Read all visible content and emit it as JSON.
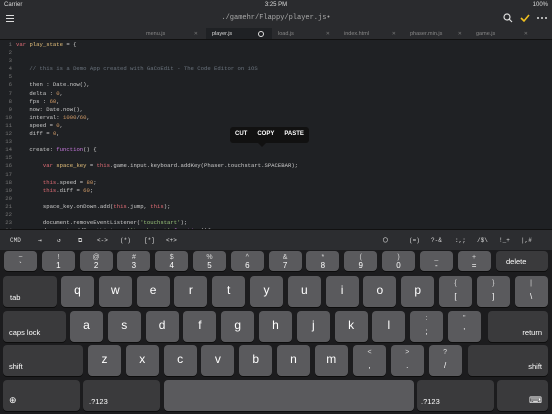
{
  "status": {
    "carrier": "Carrier",
    "time": "3:25 PM",
    "battery": "100%"
  },
  "title": {
    "path": "./gamehr/Flappy/player.js•"
  },
  "tabs": [
    {
      "label": "menu.js",
      "active": false
    },
    {
      "label": "player.js",
      "active": true
    },
    {
      "label": "load.js",
      "active": false
    },
    {
      "label": "index.html",
      "active": false
    },
    {
      "label": "phaser.min.js",
      "active": false
    },
    {
      "label": "game.js",
      "active": false
    }
  ],
  "code": {
    "lines": [
      {
        "n": "1",
        "segs": [
          [
            "kw",
            "var "
          ],
          [
            "var",
            "play_state"
          ],
          [
            "plain",
            " = {"
          ]
        ]
      },
      {
        "n": "2",
        "segs": []
      },
      {
        "n": "3",
        "segs": []
      },
      {
        "n": "4",
        "segs": [
          [
            "comment",
            "    // this is a Demo App created with GaCoEdit - The Code Editor on iOS"
          ]
        ]
      },
      {
        "n": "5",
        "segs": []
      },
      {
        "n": "6",
        "segs": [
          [
            "plain",
            "    then : Date.now(),"
          ]
        ]
      },
      {
        "n": "7",
        "segs": [
          [
            "plain",
            "    delta : "
          ],
          [
            "num",
            "0"
          ],
          [
            "plain",
            ","
          ]
        ]
      },
      {
        "n": "8",
        "segs": [
          [
            "plain",
            "    fps : "
          ],
          [
            "num",
            "60"
          ],
          [
            "plain",
            ","
          ]
        ]
      },
      {
        "n": "9",
        "segs": [
          [
            "plain",
            "    now: Date.now(),"
          ]
        ]
      },
      {
        "n": "10",
        "segs": [
          [
            "plain",
            "    interval: "
          ],
          [
            "num",
            "1000"
          ],
          [
            "plain",
            "/"
          ],
          [
            "num",
            "60"
          ],
          [
            "plain",
            ","
          ]
        ]
      },
      {
        "n": "11",
        "segs": [
          [
            "plain",
            "    speed = "
          ],
          [
            "num",
            "0"
          ],
          [
            "plain",
            ","
          ]
        ]
      },
      {
        "n": "12",
        "segs": [
          [
            "plain",
            "    diff = "
          ],
          [
            "num",
            "0"
          ],
          [
            "plain",
            ","
          ]
        ]
      },
      {
        "n": "13",
        "segs": []
      },
      {
        "n": "14",
        "segs": [
          [
            "plain",
            "    create: "
          ],
          [
            "fn",
            "function"
          ],
          [
            "plain",
            "() {"
          ]
        ]
      },
      {
        "n": "15",
        "segs": []
      },
      {
        "n": "16",
        "segs": [
          [
            "plain",
            "        "
          ],
          [
            "kw",
            "var "
          ],
          [
            "var",
            "space_key"
          ],
          [
            "plain",
            " = "
          ],
          [
            "kw",
            "this"
          ],
          [
            "plain",
            ".game.input.keyboard.addKey(Phaser."
          ],
          [
            "sel",
            "touchstart"
          ],
          [
            "plain",
            ".SPACEBAR);"
          ]
        ]
      },
      {
        "n": "17",
        "segs": []
      },
      {
        "n": "18",
        "segs": [
          [
            "plain",
            "        "
          ],
          [
            "kw",
            "this"
          ],
          [
            "plain",
            ".speed = "
          ],
          [
            "num",
            "80"
          ],
          [
            "plain",
            ";"
          ]
        ]
      },
      {
        "n": "19",
        "segs": [
          [
            "plain",
            "        "
          ],
          [
            "kw",
            "this"
          ],
          [
            "plain",
            ".diff = "
          ],
          [
            "num",
            "60"
          ],
          [
            "plain",
            ";"
          ]
        ]
      },
      {
        "n": "20",
        "segs": []
      },
      {
        "n": "21",
        "segs": [
          [
            "plain",
            "        space_key.onDown.add("
          ],
          [
            "kw",
            "this"
          ],
          [
            "plain",
            ".jump, "
          ],
          [
            "kw",
            "this"
          ],
          [
            "plain",
            ");"
          ]
        ]
      },
      {
        "n": "22",
        "segs": []
      },
      {
        "n": "23",
        "segs": [
          [
            "plain",
            "        document.removeEventListener("
          ],
          [
            "str",
            "'touchstart'"
          ],
          [
            "plain",
            ");"
          ]
        ]
      },
      {
        "n": "24",
        "segs": [
          [
            "plain",
            "        document.addEventListener("
          ],
          [
            "str",
            "'touchstart'"
          ],
          [
            "plain",
            ","
          ],
          [
            "fn",
            "function"
          ],
          [
            "plain",
            "(){"
          ]
        ]
      }
    ]
  },
  "context_menu": [
    "CUT",
    "COPY",
    "PASTE"
  ],
  "accessory": {
    "left": [
      "CMD",
      "⇥",
      "↺",
      "⧉",
      "<->",
      "(*)",
      "[*]",
      "<+>"
    ],
    "right": [
      "◯",
      "(=)",
      "?-&",
      ":,;",
      "/$\\",
      "!_+",
      "|,#"
    ]
  },
  "keyboard": {
    "row1": [
      [
        "~",
        "`"
      ],
      [
        "!",
        "1"
      ],
      [
        "@",
        "2"
      ],
      [
        "#",
        "3"
      ],
      [
        "$",
        "4"
      ],
      [
        "%",
        "5"
      ],
      [
        "^",
        "6"
      ],
      [
        "&",
        "7"
      ],
      [
        "*",
        "8"
      ],
      [
        "(",
        "9"
      ],
      [
        ")",
        "0"
      ],
      [
        "_",
        "-"
      ],
      [
        "+",
        "="
      ]
    ],
    "delete": "delete",
    "tab": "tab",
    "row2": [
      "q",
      "w",
      "e",
      "r",
      "t",
      "y",
      "u",
      "i",
      "o",
      "p"
    ],
    "row2_sym": [
      [
        "{",
        "["
      ],
      [
        "}",
        "]"
      ],
      [
        "|",
        "\\"
      ]
    ],
    "caps": "caps lock",
    "row3": [
      "a",
      "s",
      "d",
      "f",
      "g",
      "h",
      "j",
      "k",
      "l"
    ],
    "row3_sym": [
      [
        ":",
        ";"
      ],
      [
        "\"",
        "'"
      ]
    ],
    "return": "return",
    "shift": "shift",
    "row4": [
      "z",
      "x",
      "c",
      "v",
      "b",
      "n",
      "m"
    ],
    "row4_sym": [
      [
        "<",
        ","
      ],
      [
        ">",
        "."
      ],
      [
        "?",
        "/"
      ]
    ],
    "globe": "⊕",
    "num_label": ".?123",
    "hide": "⌨"
  }
}
